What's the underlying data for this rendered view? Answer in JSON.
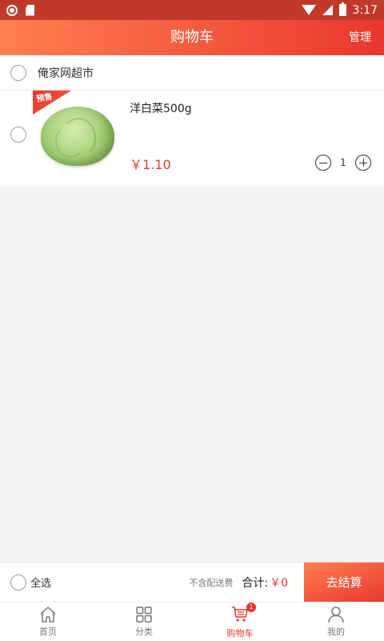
{
  "status_bar": {
    "time": "3:17"
  },
  "header": {
    "title": "购物车",
    "manage_label": "管理"
  },
  "shop": {
    "name": "俺家网超市"
  },
  "cart_items": [
    {
      "name": "洋白菜500g",
      "price": "￥1.10",
      "tag": "预售",
      "quantity": "1"
    }
  ],
  "checkout": {
    "select_all_label": "全选",
    "delivery_note": "不含配送费",
    "total_label": "合计:",
    "total_value": "￥0",
    "settle_label": "去结算"
  },
  "tabbar": {
    "items": [
      {
        "label": "首页",
        "icon": "home-icon"
      },
      {
        "label": "分类",
        "icon": "category-icon"
      },
      {
        "label": "购物车",
        "icon": "cart-icon",
        "badge": "1",
        "active": true
      },
      {
        "label": "我的",
        "icon": "user-icon"
      }
    ]
  },
  "colors": {
    "accent": "#e8372f",
    "gradient_start": "#ff7f50",
    "statusbar": "#c0392b"
  }
}
